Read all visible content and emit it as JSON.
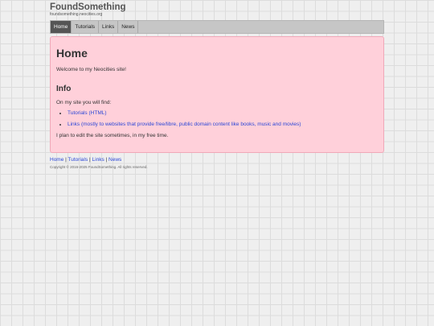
{
  "header": {
    "site_title": "FoundSomething",
    "site_url": "foundsomething.neocities.org"
  },
  "nav": [
    {
      "label": "Home",
      "active": true
    },
    {
      "label": "Tutorials",
      "active": false
    },
    {
      "label": "Links",
      "active": false
    },
    {
      "label": "News",
      "active": false
    }
  ],
  "main": {
    "heading": "Home",
    "welcome": "Welcome to my Neocities site!",
    "info_heading": "Info",
    "find_text": "On my site you will find:",
    "list": [
      "Tutorials (HTML)",
      "Links (mostly to websites that provide free/libre, public domain content like books, music and movies)"
    ],
    "plan_text": "I plan to edit the site sometimes, in my free time."
  },
  "footer": {
    "links": [
      "Home",
      "Tutorials",
      "Links",
      "News"
    ],
    "separator": " | ",
    "copyright": "Copyright © 2016-2025 FoundSomething. All rights reserved."
  },
  "colors": {
    "panel_bg": "#ffd0da",
    "link": "#2b47d6",
    "nav_active_bg": "#555555"
  }
}
